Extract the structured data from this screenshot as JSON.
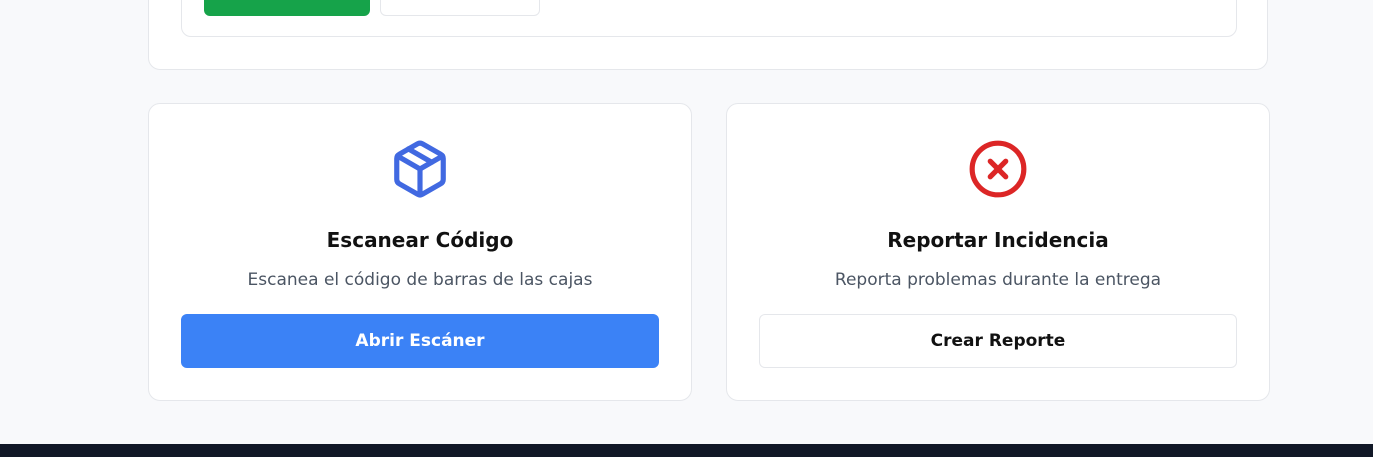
{
  "cards": {
    "scan": {
      "icon": "package-icon",
      "title": "Escanear Código",
      "description": "Escanea el código de barras de las cajas",
      "button_label": "Abrir Escáner"
    },
    "report": {
      "icon": "close-circle-icon",
      "title": "Reportar Incidencia",
      "description": "Reporta problemas durante la entrega",
      "button_label": "Crear Reporte"
    }
  },
  "colors": {
    "primary": "#3b82f6",
    "success": "#16a34a",
    "danger": "#dc2626",
    "icon_blue": "#4169e1",
    "page_bg": "#f8f9fb"
  }
}
